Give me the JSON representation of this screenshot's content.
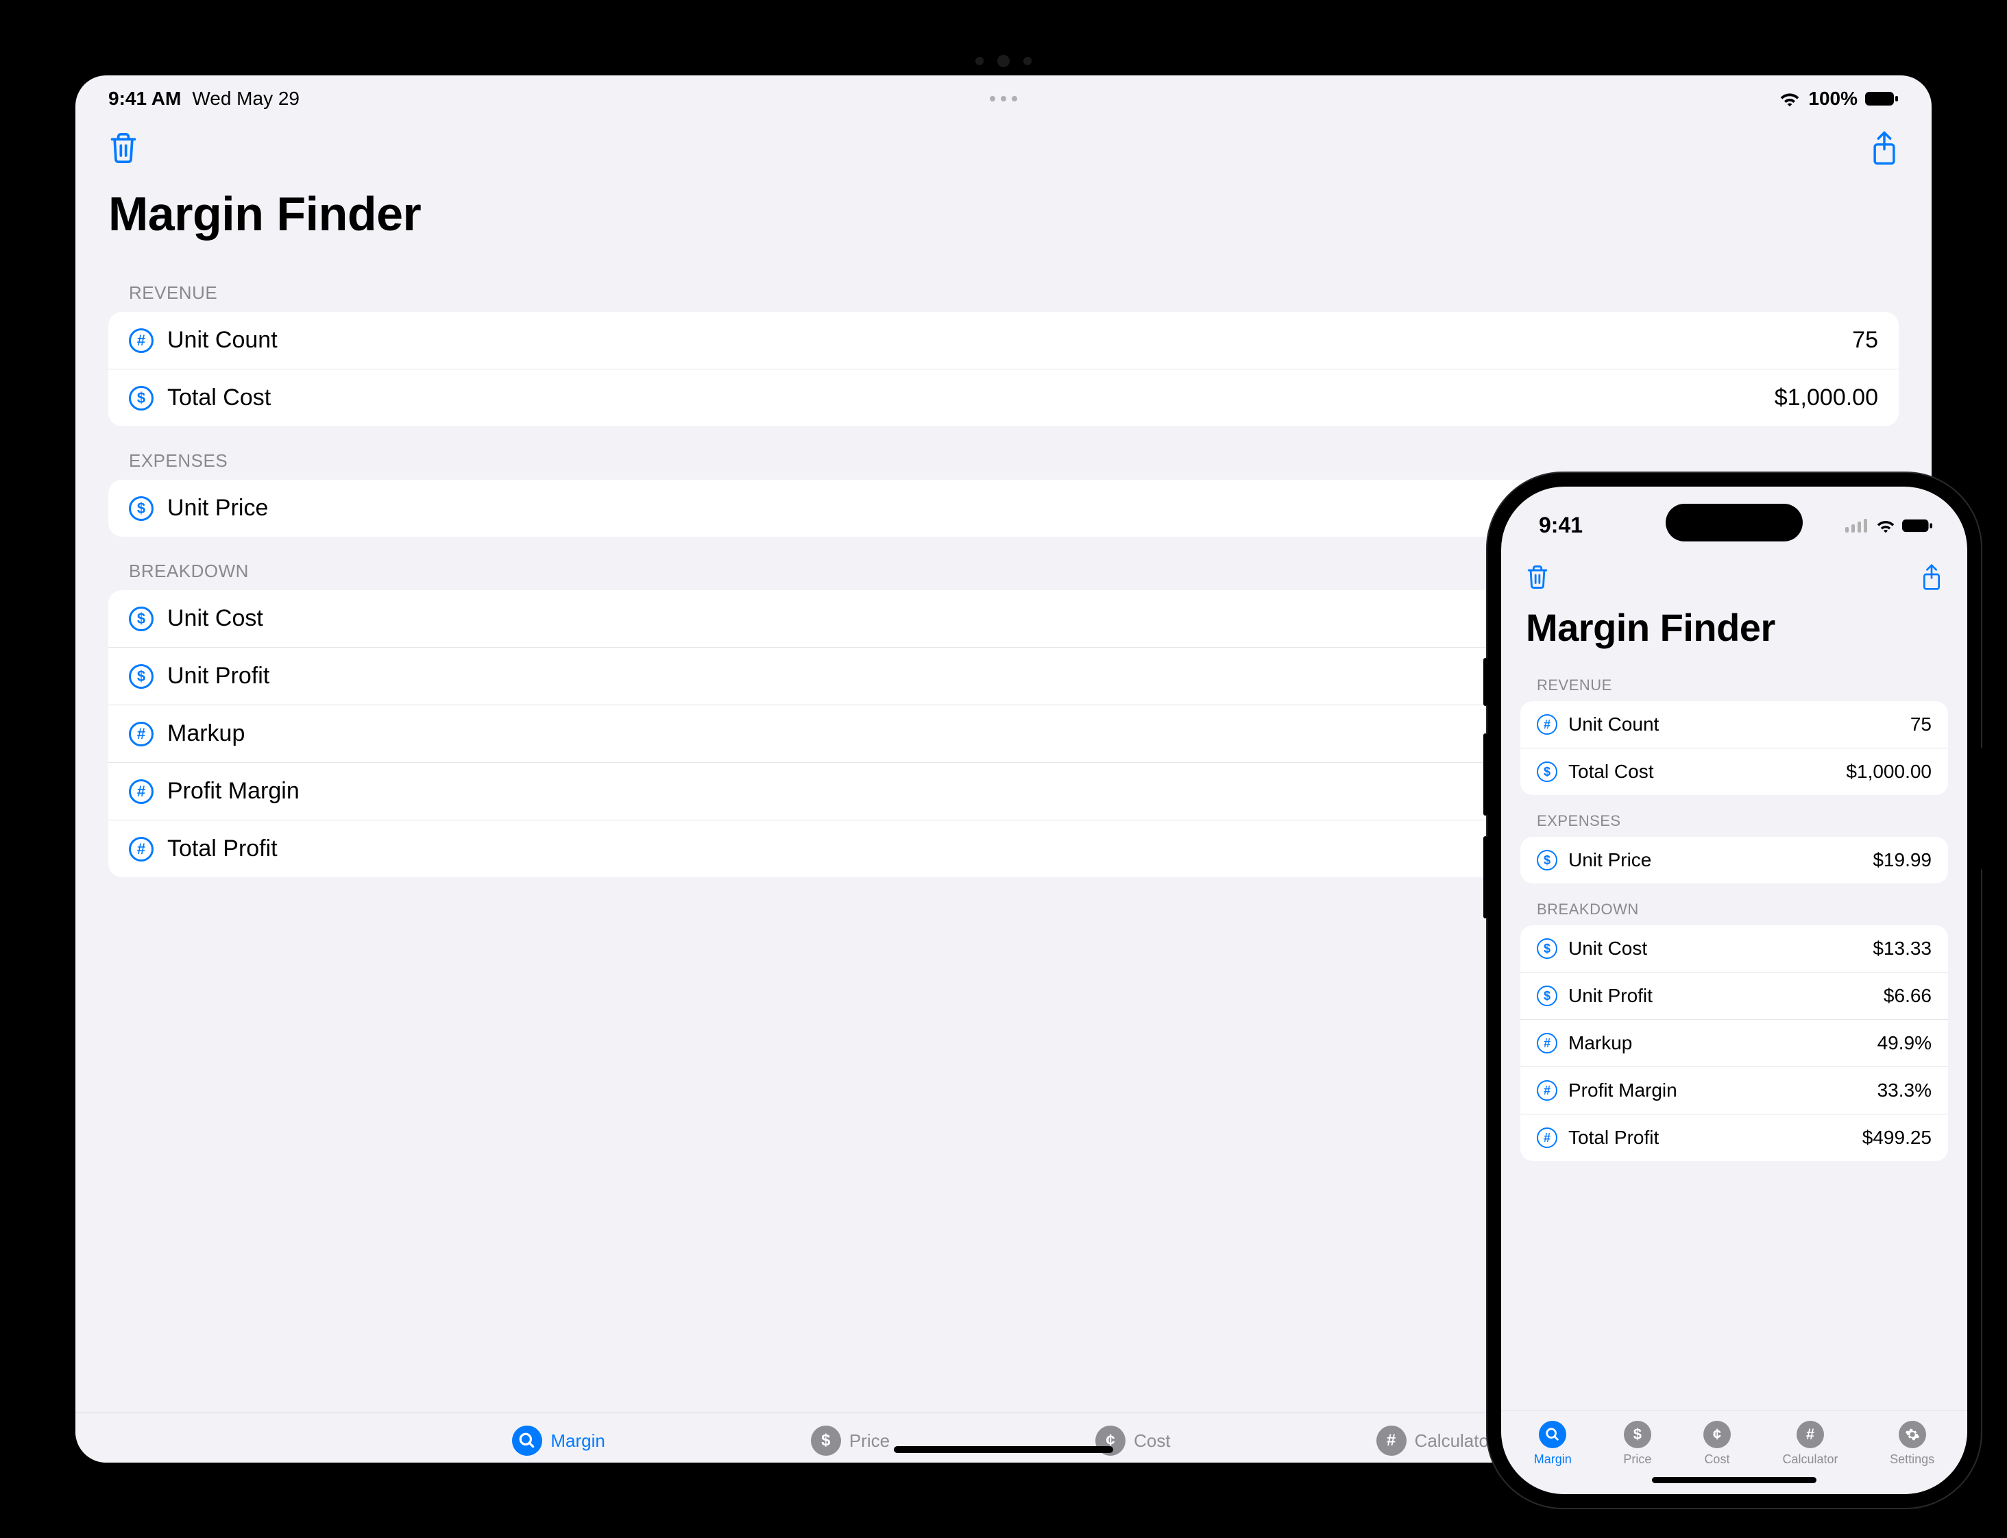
{
  "ipad": {
    "status": {
      "time": "9:41 AM",
      "date": "Wed May 29",
      "battery": "100%"
    },
    "title": "Margin Finder",
    "sections": {
      "revenue": {
        "header": "REVENUE",
        "rows": {
          "unit_count": {
            "icon": "#",
            "label": "Unit Count",
            "value": "75"
          },
          "total_cost": {
            "icon": "$",
            "label": "Total Cost",
            "value": "$1,000.00"
          }
        }
      },
      "expenses": {
        "header": "EXPENSES",
        "rows": {
          "unit_price": {
            "icon": "$",
            "label": "Unit Price",
            "value": ""
          }
        }
      },
      "breakdown": {
        "header": "BREAKDOWN",
        "rows": {
          "unit_cost": {
            "icon": "$",
            "label": "Unit Cost",
            "value": ""
          },
          "unit_profit": {
            "icon": "$",
            "label": "Unit Profit",
            "value": ""
          },
          "markup": {
            "icon": "#",
            "label": "Markup",
            "value": ""
          },
          "margin": {
            "icon": "#",
            "label": "Profit Margin",
            "value": ""
          },
          "total_profit": {
            "icon": "#",
            "label": "Total Profit",
            "value": ""
          }
        }
      }
    },
    "tabs": {
      "margin": {
        "label": "Margin"
      },
      "price": {
        "label": "Price"
      },
      "cost": {
        "label": "Cost"
      },
      "calculator": {
        "label": "Calculator"
      }
    }
  },
  "iphone": {
    "status": {
      "time": "9:41"
    },
    "title": "Margin Finder",
    "sections": {
      "revenue": {
        "header": "REVENUE",
        "rows": {
          "unit_count": {
            "icon": "#",
            "label": "Unit Count",
            "value": "75"
          },
          "total_cost": {
            "icon": "$",
            "label": "Total Cost",
            "value": "$1,000.00"
          }
        }
      },
      "expenses": {
        "header": "EXPENSES",
        "rows": {
          "unit_price": {
            "icon": "$",
            "label": "Unit Price",
            "value": "$19.99"
          }
        }
      },
      "breakdown": {
        "header": "BREAKDOWN",
        "rows": {
          "unit_cost": {
            "icon": "$",
            "label": "Unit Cost",
            "value": "$13.33"
          },
          "unit_profit": {
            "icon": "$",
            "label": "Unit Profit",
            "value": "$6.66"
          },
          "markup": {
            "icon": "#",
            "label": "Markup",
            "value": "49.9%"
          },
          "margin": {
            "icon": "#",
            "label": "Profit Margin",
            "value": "33.3%"
          },
          "total_profit": {
            "icon": "#",
            "label": "Total Profit",
            "value": "$499.25"
          }
        }
      }
    },
    "tabs": {
      "margin": {
        "label": "Margin"
      },
      "price": {
        "label": "Price"
      },
      "cost": {
        "label": "Cost"
      },
      "calculator": {
        "label": "Calculator"
      },
      "settings": {
        "label": "Settings"
      }
    }
  }
}
